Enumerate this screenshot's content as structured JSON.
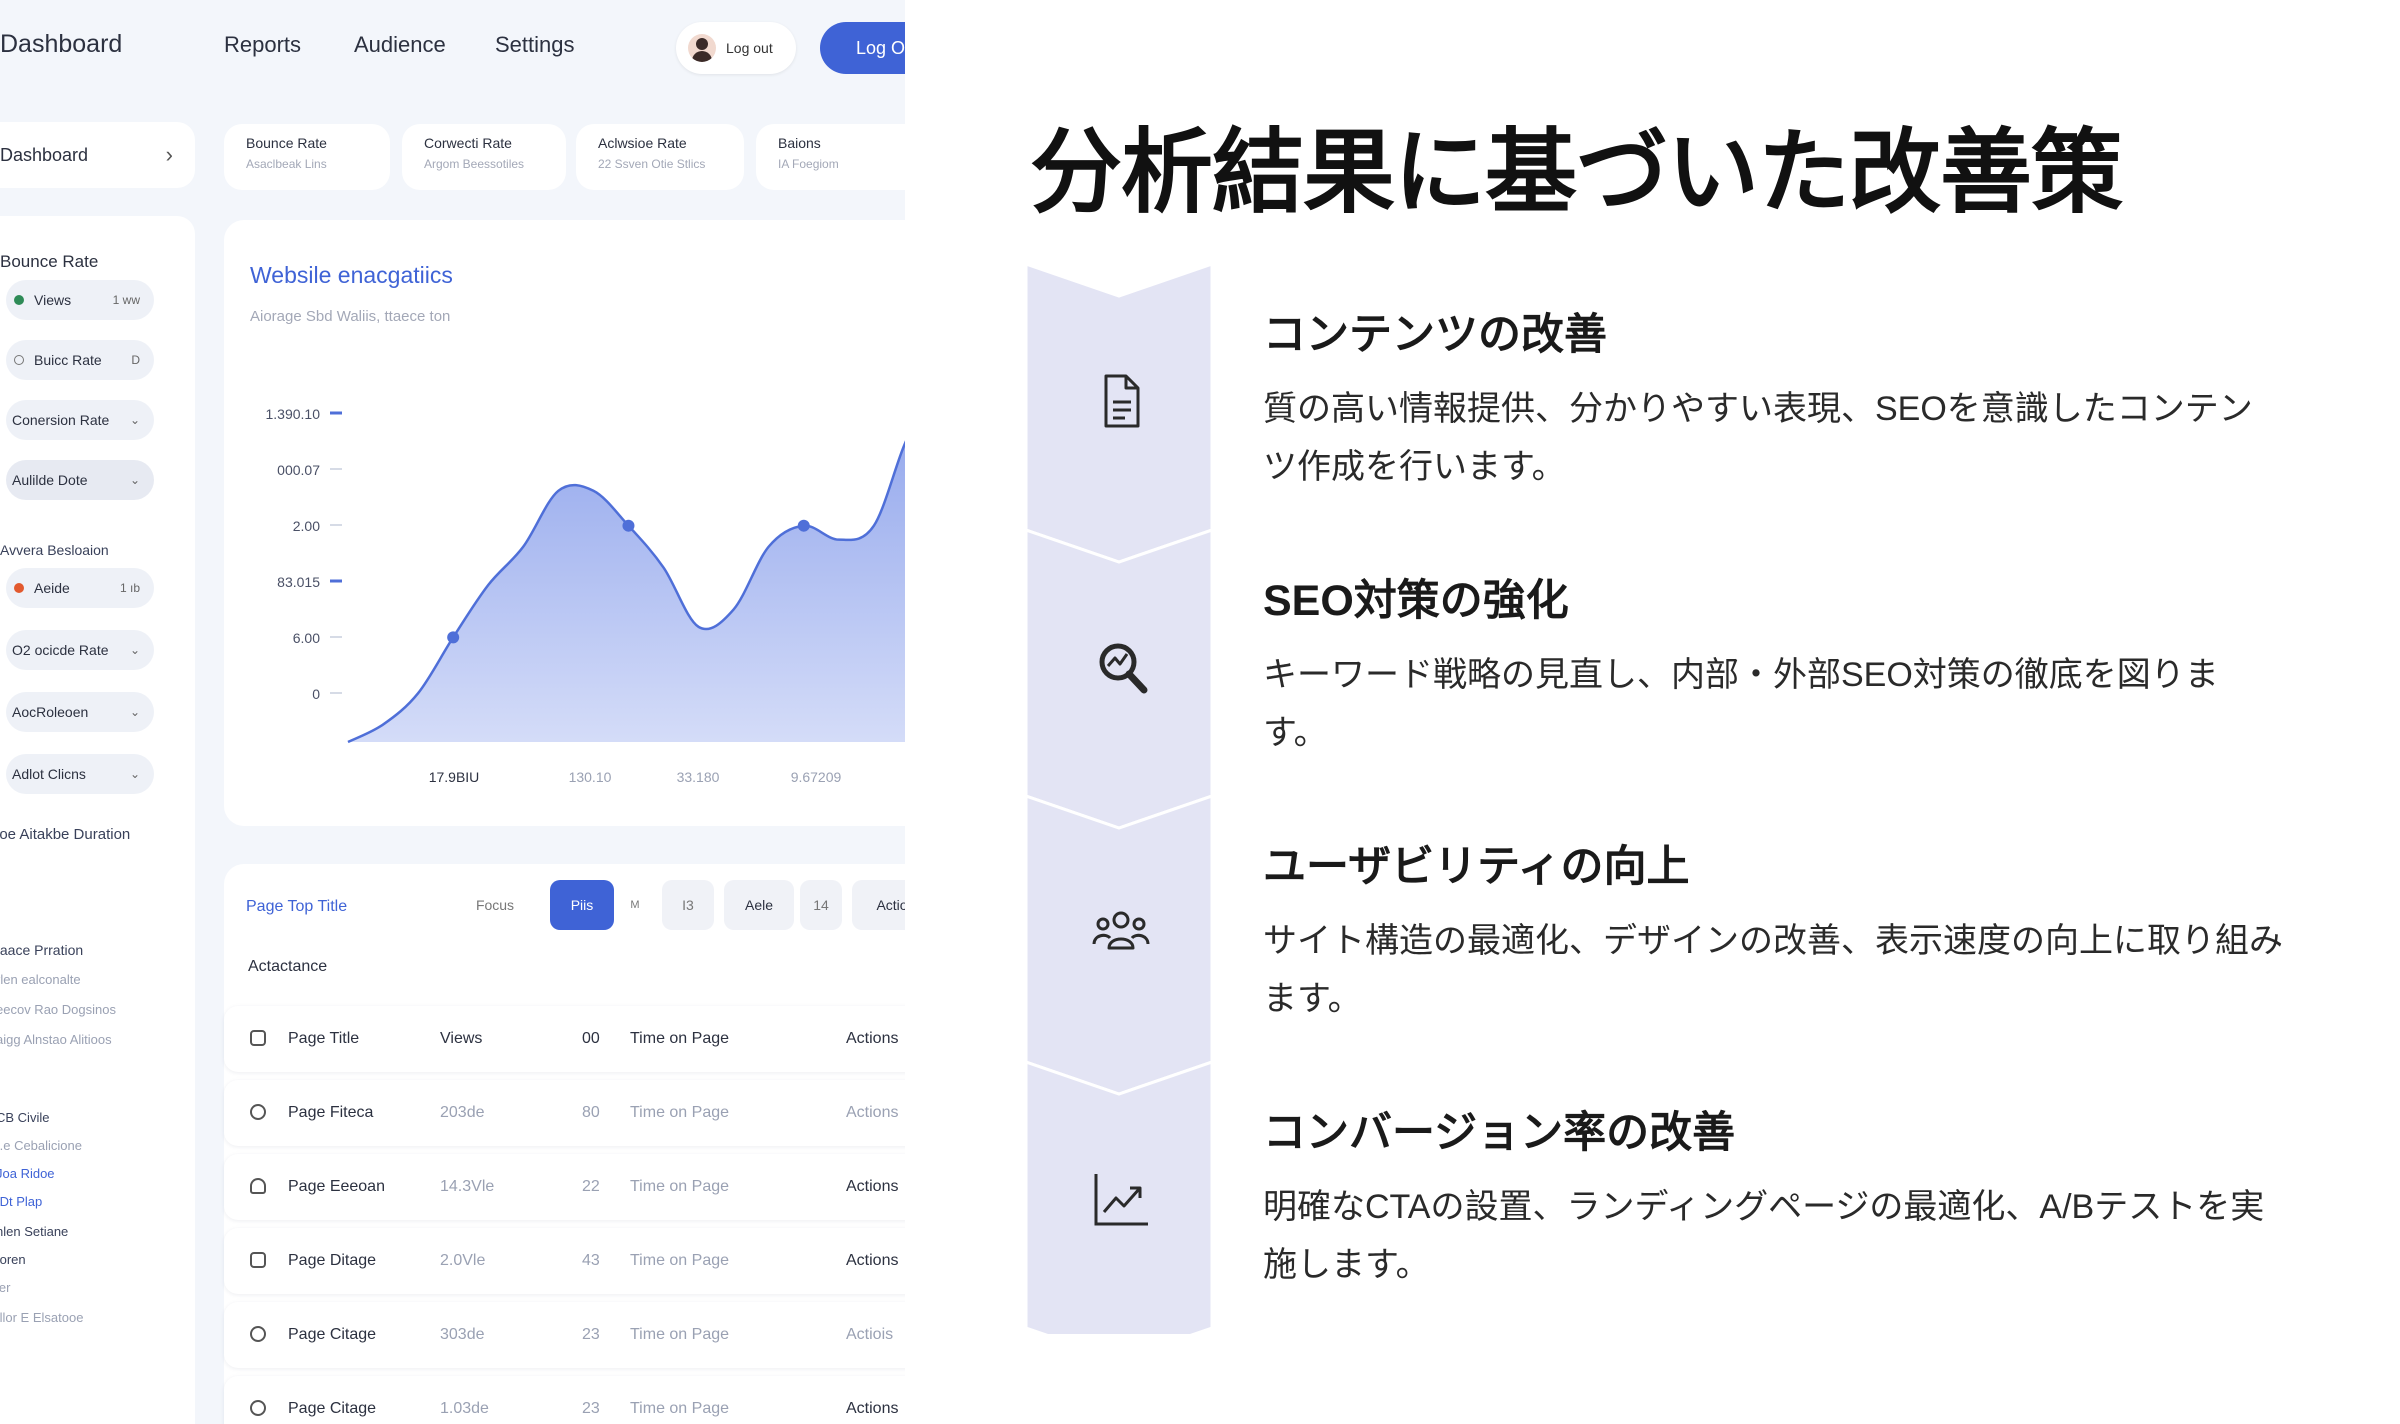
{
  "dashboard": {
    "brand": "Dashboard",
    "nav": [
      "Reports",
      "Audience",
      "Settings"
    ],
    "logout_label": "Log out",
    "login_button": "Log O",
    "side_top": "Dashboard",
    "side": {
      "section1": "Bounce Rate",
      "pill1": "Views",
      "pill1_tail": "1  ww",
      "pill2": "Buicc Rate",
      "pill2_tail": "D",
      "pill3": "Conersion Rate",
      "pill4": "Aulilde Dote",
      "section2": "Avvera Besloaion",
      "pill5": "Aeide",
      "pill5_tail": "1  ıb",
      "pill6": "O2 ocicde Rate",
      "pill7": "AocRoleoen",
      "pill8": "Adlot Clicns",
      "duration": "ioe Aitakbe Duration",
      "misc1": "taace Prration",
      "misc2": "rlen ealconalte",
      "misc3": "eecov Rao Dogsinos",
      "misc4": "aigg Alnstao Alitioos",
      "misc5": "CB Civile",
      "misc6": "ı.e Cebalicione",
      "misc7": "Joa Ridoe",
      "misc8": "IDt Plap",
      "misc9": "nlen Setiane",
      "misc10": "toren",
      "misc11": "ier",
      "misc12": "ıllor E Elsatooe"
    },
    "metrics": [
      {
        "title": "Bounce Rate",
        "sub": "Asaclbeak Lins"
      },
      {
        "title": "Corwecti Rate",
        "sub": "Argom Beessotiles"
      },
      {
        "title": "Aclwsioe Rate",
        "sub": "22 Ssven Otie Stlics"
      },
      {
        "title": "Baions",
        "sub": "IA Foegiom"
      }
    ],
    "chart_card": {
      "title": "Websile enacgatiics",
      "subtitle": "Aiorage Sbd Waliis, ttaece ton"
    },
    "table": {
      "title": "Page Top Title",
      "filters": [
        "Focus",
        "Piis",
        "M",
        "I3",
        "Aele",
        "14",
        "Actio"
      ],
      "subtitle": "Actactance",
      "header": [
        "Page Title",
        "Views",
        "00",
        "Time on Page",
        "Actions"
      ],
      "rows": [
        [
          "Page Fiteca",
          "203de",
          "80",
          "Time on Page",
          "Actions"
        ],
        [
          "Page Eeeoan",
          "14.3Vle",
          "22",
          "Time on Page",
          "Actions"
        ],
        [
          "Page Ditage",
          "2.0Vle",
          "43",
          "Time on Page",
          "Actions"
        ],
        [
          "Page Citage",
          "303de",
          "23",
          "Time on Page",
          "Actiois"
        ],
        [
          "Page Citage",
          "1.03de",
          "23",
          "Time on Page",
          "Actions"
        ]
      ]
    }
  },
  "chart_data": {
    "type": "area",
    "title": "Websile enacgatiics",
    "subtitle": "Aiorage Sbd Waliis, ttaece ton",
    "y_tick_labels": [
      "1.390.10",
      "000.07",
      "2.00",
      "83.015",
      "6.00",
      "0"
    ],
    "x_tick_labels": [
      "17.9BIU",
      "130.10",
      "33.180",
      "9.67209"
    ],
    "y_normalized": [
      0,
      0.05,
      0.14,
      0.3,
      0.45,
      0.56,
      0.72,
      0.72,
      0.62,
      0.5,
      0.33,
      0.38,
      0.56,
      0.62,
      0.58,
      0.62,
      0.88,
      1.0
    ],
    "highlighted_points": [
      3,
      8,
      13
    ],
    "colors": {
      "line": "#4f6fd8",
      "fill_top": "#8fa4ec",
      "fill_bottom": "#d4dcf8"
    }
  },
  "slide": {
    "heading": "分析結果に基づいた改善策",
    "items": [
      {
        "icon": "document-icon",
        "title": "コンテンツの改善",
        "desc": "質の高い情報提供、分かりやすい表現、SEOを意識したコンテンツ作成を行います。"
      },
      {
        "icon": "search-analytics-icon",
        "title": "SEO対策の強化",
        "desc": "キーワード戦略の見直し、内部・外部SEO対策の徹底を図ります。"
      },
      {
        "icon": "users-icon",
        "title": "ユーザビリティの向上",
        "desc": "サイト構造の最適化、デザインの改善、表示速度の向上に取り組みます。"
      },
      {
        "icon": "trend-chart-icon",
        "title": "コンバージョン率の改善",
        "desc": "明確なCTAの設置、ランディングページの最適化、A/Bテストを実施します。"
      }
    ],
    "colors": {
      "chevron": "#e3e4f4",
      "chevron_stroke": "#ffffff",
      "accent": "#3f63d6"
    }
  }
}
